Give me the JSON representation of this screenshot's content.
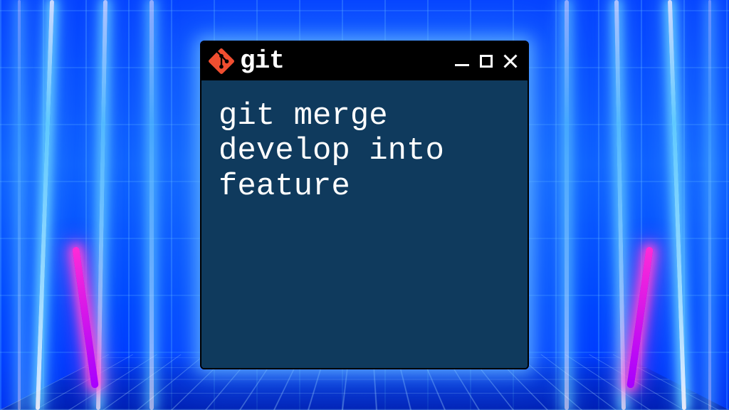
{
  "background": {
    "theme": "neon-circuit",
    "accent_hex": "#5fc9ff",
    "magenta_hex": "#ff2bd6",
    "base_hex": "#0b2fe0"
  },
  "terminal": {
    "title": "git",
    "logo_name": "git-logo-icon",
    "body_bg_hex": "#0f3a5d",
    "text_color_hex": "#ffffff",
    "command": "git merge develop into feature",
    "window_controls": {
      "minimize": "minimize",
      "maximize": "maximize",
      "close": "close"
    }
  }
}
